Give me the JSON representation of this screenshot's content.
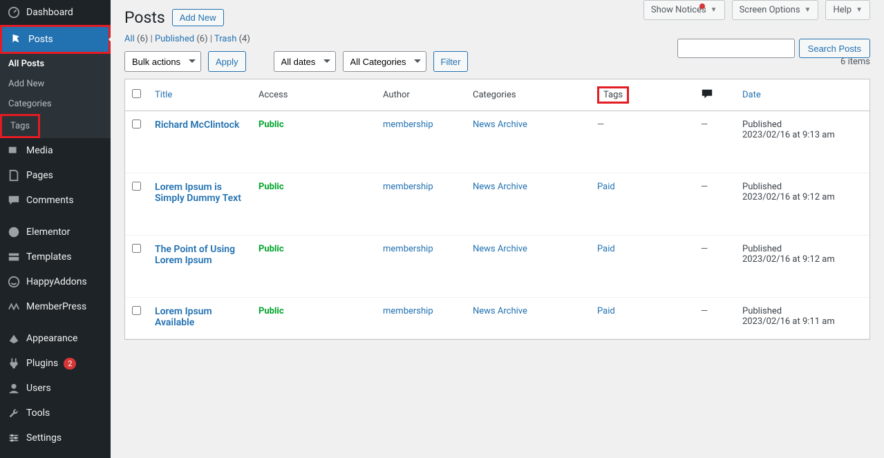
{
  "topbar": {
    "show_notices": "Show Notices",
    "screen_options": "Screen Options",
    "help": "Help"
  },
  "sidebar": {
    "dashboard": "Dashboard",
    "posts": "Posts",
    "submenu": {
      "all_posts": "All Posts",
      "add_new": "Add New",
      "categories": "Categories",
      "tags": "Tags"
    },
    "media": "Media",
    "pages": "Pages",
    "comments": "Comments",
    "elementor": "Elementor",
    "templates": "Templates",
    "happyaddons": "HappyAddons",
    "memberpress": "MemberPress",
    "appearance": "Appearance",
    "plugins": "Plugins",
    "plugins_badge": "2",
    "users": "Users",
    "tools": "Tools",
    "settings": "Settings"
  },
  "page": {
    "title": "Posts",
    "add_new": "Add New"
  },
  "filters": {
    "all": "All",
    "all_count": "(6)",
    "published": "Published",
    "published_count": "(6)",
    "trash": "Trash",
    "trash_count": "(4)",
    "sep": " | "
  },
  "bulk": {
    "bulk_actions": "Bulk actions",
    "apply": "Apply",
    "all_dates": "All dates",
    "all_categories": "All Categories",
    "filter": "Filter"
  },
  "search": {
    "placeholder": "",
    "button": "Search Posts"
  },
  "count": "6 items",
  "table": {
    "headers": {
      "title": "Title",
      "access": "Access",
      "author": "Author",
      "categories": "Categories",
      "tags": "Tags",
      "date": "Date"
    },
    "rows": [
      {
        "title": "Richard McClintock",
        "access": "Public",
        "author": "membership",
        "categories": "News Archive",
        "tags": "—",
        "comments": "—",
        "date_state": "Published",
        "date_value": "2023/02/16 at 9:13 am"
      },
      {
        "title": "Lorem Ipsum is Simply Dummy Text",
        "access": "Public",
        "author": "membership",
        "categories": "News Archive",
        "tags": "Paid",
        "comments": "—",
        "date_state": "Published",
        "date_value": "2023/02/16 at 9:12 am"
      },
      {
        "title": "The Point of Using Lorem Ipsum",
        "access": "Public",
        "author": "membership",
        "categories": "News Archive",
        "tags": "Paid",
        "comments": "—",
        "date_state": "Published",
        "date_value": "2023/02/16 at 9:12 am"
      },
      {
        "title": "Lorem Ipsum Available",
        "access": "Public",
        "author": "membership",
        "categories": "News Archive",
        "tags": "Paid",
        "comments": "—",
        "date_state": "Published",
        "date_value": "2023/02/16 at 9:11 am"
      }
    ]
  }
}
